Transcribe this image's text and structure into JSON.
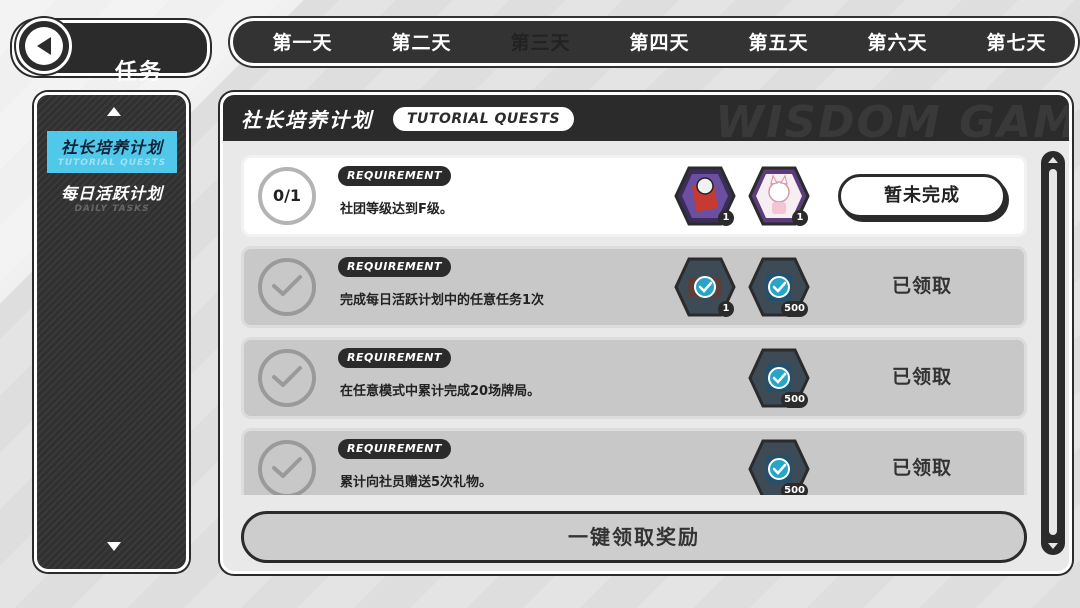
{
  "header": {
    "title": "任务"
  },
  "days": [
    {
      "label": "第一天",
      "active": false
    },
    {
      "label": "第二天",
      "active": false
    },
    {
      "label": "第三天",
      "active": true
    },
    {
      "label": "第四天",
      "active": false
    },
    {
      "label": "第五天",
      "active": false
    },
    {
      "label": "第六天",
      "active": false
    },
    {
      "label": "第七天",
      "active": false
    }
  ],
  "sidebar": {
    "items": [
      {
        "label": "社长培养计划",
        "sub": "TUTORIAL QUESTS",
        "active": true
      },
      {
        "label": "每日活跃计划",
        "sub": "DAILY TASKS",
        "active": false
      }
    ]
  },
  "panel": {
    "title": "社长培养计划",
    "tag": "TUTORIAL QUESTS",
    "watermark": "WISDOM GAM"
  },
  "quests": [
    {
      "progress": "0/1",
      "requirement_label": "REQUIREMENT",
      "description": "社团等级达到F级。",
      "status": "暂未完成",
      "claimed": false,
      "rewards": [
        {
          "icon": "character-card-icon",
          "count": "1"
        },
        {
          "icon": "cat-costume-icon",
          "count": "1"
        }
      ]
    },
    {
      "progress": "",
      "requirement_label": "REQUIREMENT",
      "description": "完成每日活跃计划中的任意任务1次",
      "status": "已领取",
      "claimed": true,
      "rewards": [
        {
          "icon": "game-console-icon",
          "count": "1"
        },
        {
          "icon": "blue-token-icon",
          "count": "500"
        }
      ]
    },
    {
      "progress": "",
      "requirement_label": "REQUIREMENT",
      "description": "在任意模式中累计完成20场牌局。",
      "status": "已领取",
      "claimed": true,
      "rewards": [
        {
          "icon": "blue-token-icon",
          "count": "500"
        }
      ]
    },
    {
      "progress": "",
      "requirement_label": "REQUIREMENT",
      "description": "累计向社员赠送5次礼物。",
      "status": "已领取",
      "claimed": true,
      "rewards": [
        {
          "icon": "blue-token-icon",
          "count": "500"
        }
      ]
    }
  ],
  "claim_all": {
    "label": "一键领取奖励"
  },
  "colors": {
    "dark": "#2b2b2b",
    "accent": "#4fc8ea",
    "claimed_bg": "#c8c8c8",
    "active_bg": "#ffffff"
  }
}
